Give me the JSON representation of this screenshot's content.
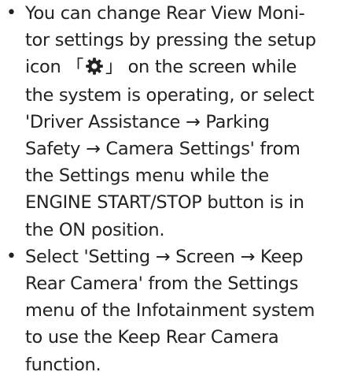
{
  "bullet_marker": "•",
  "items": [
    {
      "line1": "You can change Rear View Moni-",
      "line2": "tor settings by pressing the setup",
      "line3_before_icon": "icon ",
      "line3_bracket_open": "「",
      "line3_icon": "gear-icon",
      "line3_bracket_close": "」",
      "line3_after_icon": " on the screen while",
      "line4": "the system is operating, or select",
      "line5": "'Driver Assistance → Parking",
      "line6": "Safety → Camera Settings' from",
      "line7": "the Settings menu while the",
      "line8": "ENGINE START/STOP button is in",
      "line9": "the ON position."
    },
    {
      "line1": "Select 'Setting → Screen → Keep",
      "line2": "Rear Camera' from the Settings",
      "line3": "menu of the Infotainment system",
      "line4": "to use the Keep Rear Camera",
      "line5": "function."
    }
  ]
}
